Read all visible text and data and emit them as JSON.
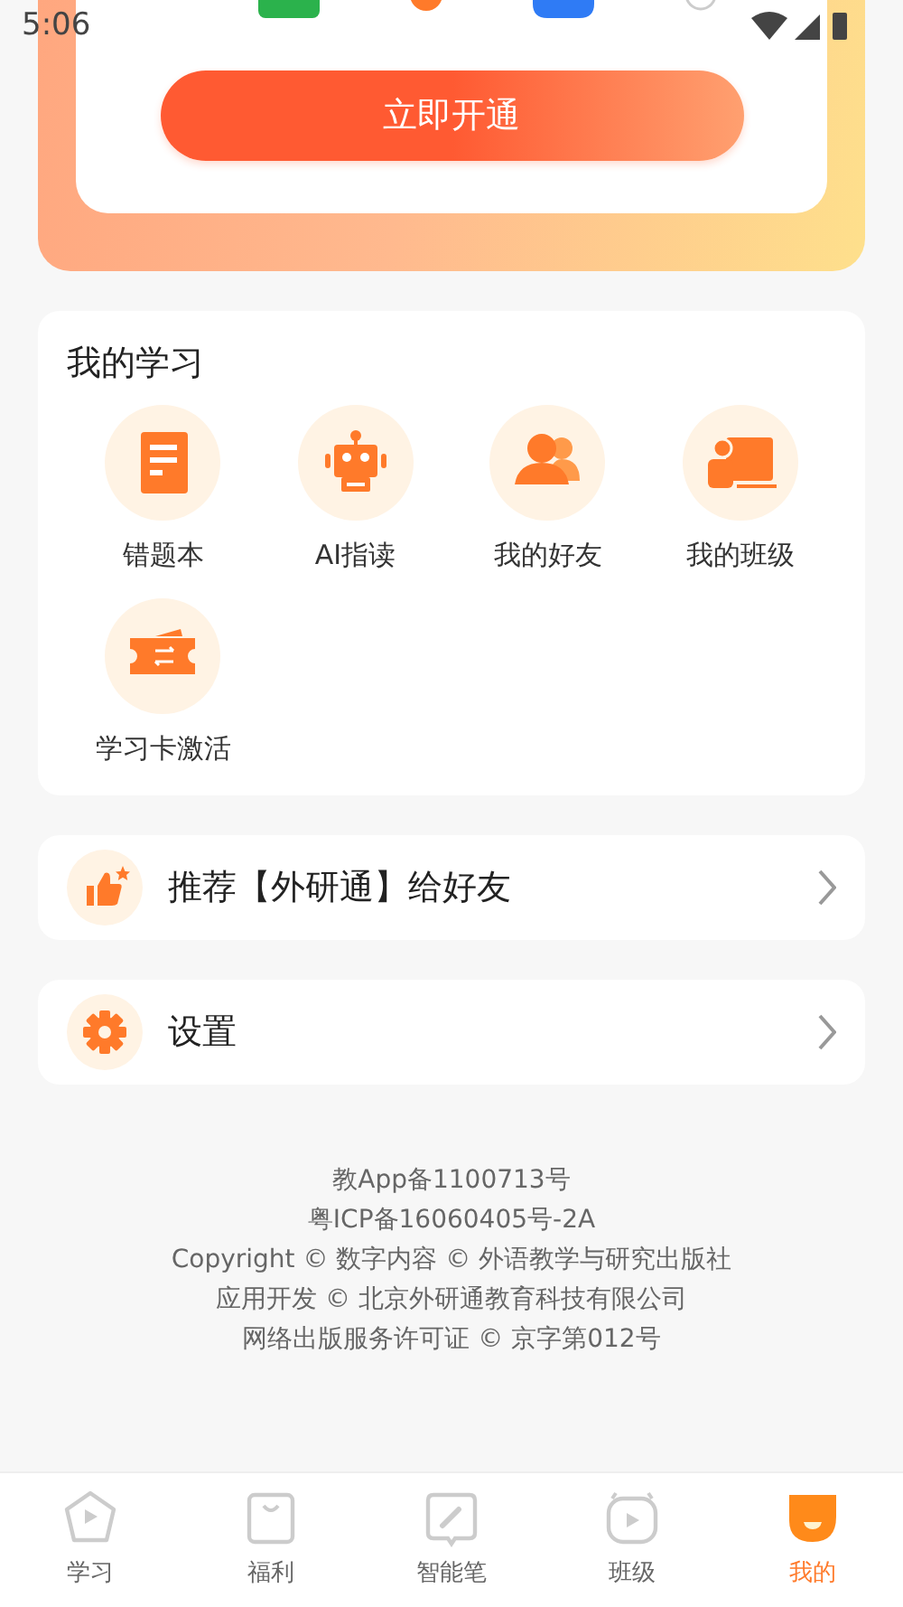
{
  "status_bar": {
    "time": "5:06"
  },
  "promo": {
    "button": "立即开通"
  },
  "my_study": {
    "title": "我的学习",
    "items": [
      {
        "label": "错题本",
        "kind": "notebook"
      },
      {
        "label": "AI指读",
        "kind": "robot"
      },
      {
        "label": "我的好友",
        "kind": "friends"
      },
      {
        "label": "我的班级",
        "kind": "class"
      },
      {
        "label": "学习卡激活",
        "kind": "ticket"
      }
    ]
  },
  "menu": [
    {
      "label": "推荐【外研通】给好友",
      "kind": "thumb"
    },
    {
      "label": "设置",
      "kind": "gear"
    }
  ],
  "footer": [
    "教App备1100713号",
    "粤ICP备16060405号-2A",
    "Copyright © 数字内容 © 外语教学与研究出版社",
    "应用开发 © 北京外研通教育科技有限公司",
    "网络出版服务许可证 © 京字第012号"
  ],
  "tabs": [
    {
      "label": "学习",
      "kind": "study",
      "selected": false
    },
    {
      "label": "福利",
      "kind": "bag",
      "selected": false
    },
    {
      "label": "智能笔",
      "kind": "pen",
      "selected": false
    },
    {
      "label": "班级",
      "kind": "class",
      "selected": false
    },
    {
      "label": "我的",
      "kind": "me",
      "selected": true
    }
  ]
}
